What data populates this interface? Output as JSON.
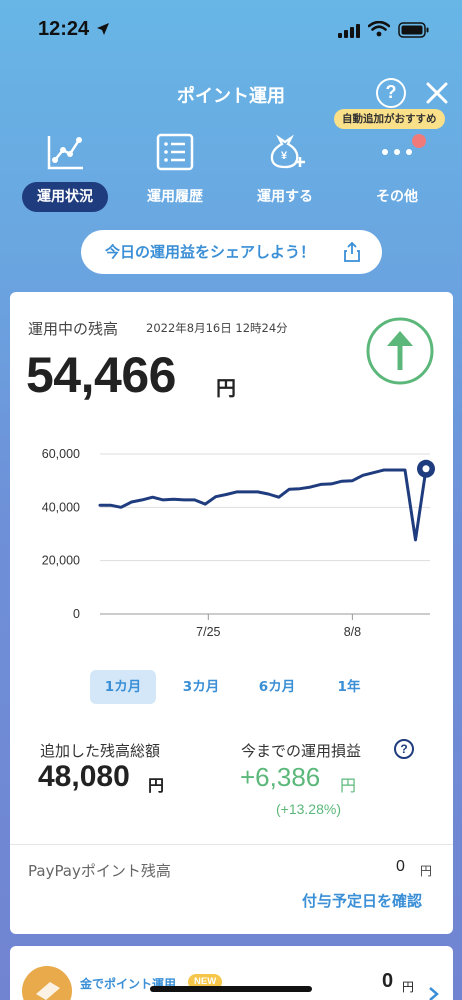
{
  "status": {
    "time": "12:24"
  },
  "header": {
    "title": "ポイント運用",
    "help_label": "?",
    "badge_hint": "自動追加がおすすめ"
  },
  "nav": {
    "items": [
      {
        "label": "運用状況",
        "icon": "line-chart-icon",
        "active": true
      },
      {
        "label": "運用履歴",
        "icon": "list-icon",
        "active": false
      },
      {
        "label": "運用する",
        "icon": "money-bag-plus-icon",
        "active": false
      },
      {
        "label": "その他",
        "icon": "more-dots-icon",
        "active": false
      }
    ]
  },
  "share": {
    "label": "今日の運用益をシェアしよう！"
  },
  "balance": {
    "label": "運用中の残高",
    "datetime": "2022年8月16日 12時24分",
    "value": "54,466",
    "unit": "円",
    "trend": "up"
  },
  "chart_data": {
    "type": "line",
    "ylim": [
      0,
      60000
    ],
    "y_ticks": [
      "60,000",
      "40,000",
      "20,000",
      "0"
    ],
    "x_ticks": [
      "7/25",
      "8/8"
    ],
    "series": [
      {
        "values": [
          40800,
          40800,
          40000,
          42000,
          42800,
          43800,
          42800,
          43000,
          42800,
          42800,
          41200,
          44000,
          44800,
          45800,
          45800,
          45800,
          45000,
          43800,
          46800,
          47000,
          47600,
          48600,
          48800,
          49800,
          50000,
          52000,
          53000,
          54000,
          54000,
          54000,
          27800,
          54466
        ]
      }
    ],
    "color": "#1f3c7e",
    "grid": true
  },
  "periods": [
    {
      "label": "1カ月",
      "active": true
    },
    {
      "label": "3カ月",
      "active": false
    },
    {
      "label": "6カ月",
      "active": false
    },
    {
      "label": "1年",
      "active": false
    }
  ],
  "added": {
    "label": "追加した残高総額",
    "value": "48,080",
    "unit": "円"
  },
  "profit": {
    "label": "今までの運用損益",
    "help_label": "?",
    "value": "+6,386",
    "unit": "円",
    "percent": "(+13.28%)"
  },
  "paypay": {
    "label": "PayPayポイント残高",
    "value": "0",
    "unit": "円",
    "link": "付与予定日を確認"
  },
  "gold": {
    "title": "金でポイント運用",
    "badge": "NEW",
    "value": "0",
    "unit": "円"
  },
  "colors": {
    "accent": "#3a8fd6",
    "navy": "#1f3c7e",
    "gain": "#5cb87a",
    "badge": "#fbe08a"
  }
}
